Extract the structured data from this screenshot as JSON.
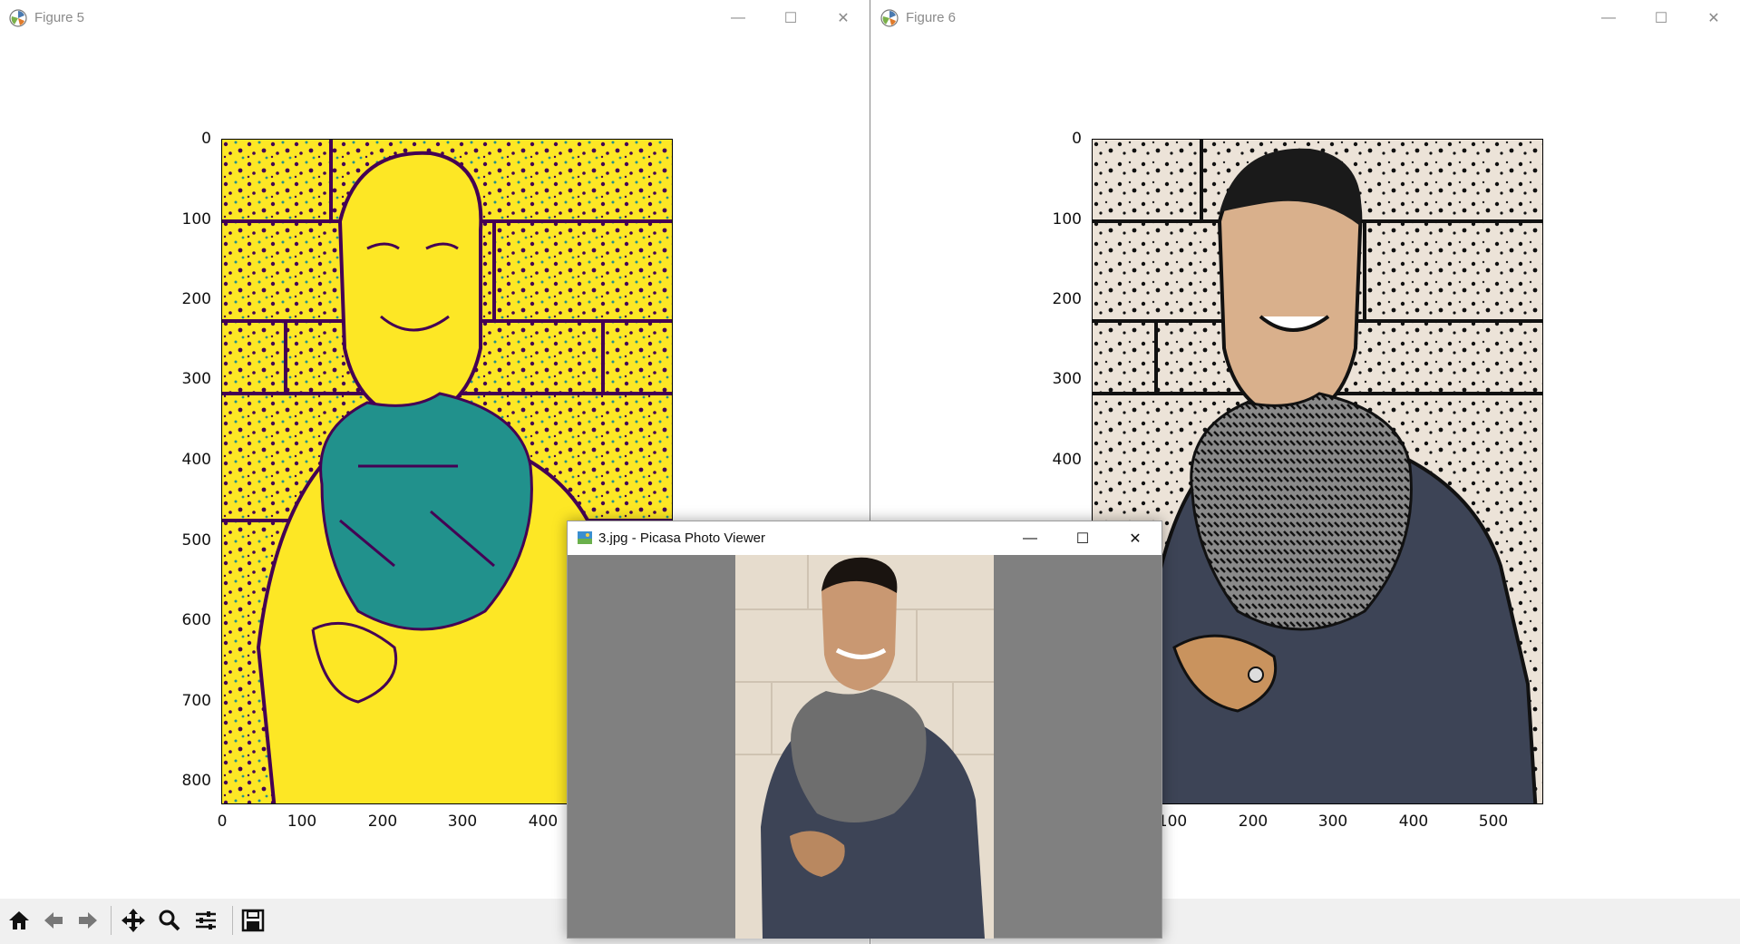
{
  "windows": {
    "figure5": {
      "title": "Figure 5",
      "y_ticks": [
        "0",
        "100",
        "200",
        "300",
        "400",
        "500",
        "600",
        "700",
        "800"
      ],
      "x_ticks": [
        "0",
        "100",
        "200",
        "300",
        "400"
      ]
    },
    "figure6": {
      "title": "Figure 6",
      "y_ticks": [
        "0",
        "100",
        "200",
        "300",
        "400"
      ],
      "x_ticks": [
        "100",
        "200",
        "300",
        "400",
        "500"
      ]
    },
    "picasa": {
      "title": "3.jpg - Picasa Photo Viewer"
    }
  },
  "toolbar": {
    "icons": [
      "home-icon",
      "back-icon",
      "forward-icon",
      "pan-icon",
      "zoom-icon",
      "configure-subplots-icon",
      "save-icon"
    ]
  },
  "window_controls": {
    "minimize": "—",
    "maximize": "☐",
    "close": "✕"
  },
  "colors": {
    "viridis_yellow": "#fde725",
    "viridis_purple": "#440154",
    "viridis_teal": "#21918c",
    "picasa_gray": "#808080",
    "wall_beige": "#e8ddd0",
    "shirt_navy": "#3d4456"
  }
}
